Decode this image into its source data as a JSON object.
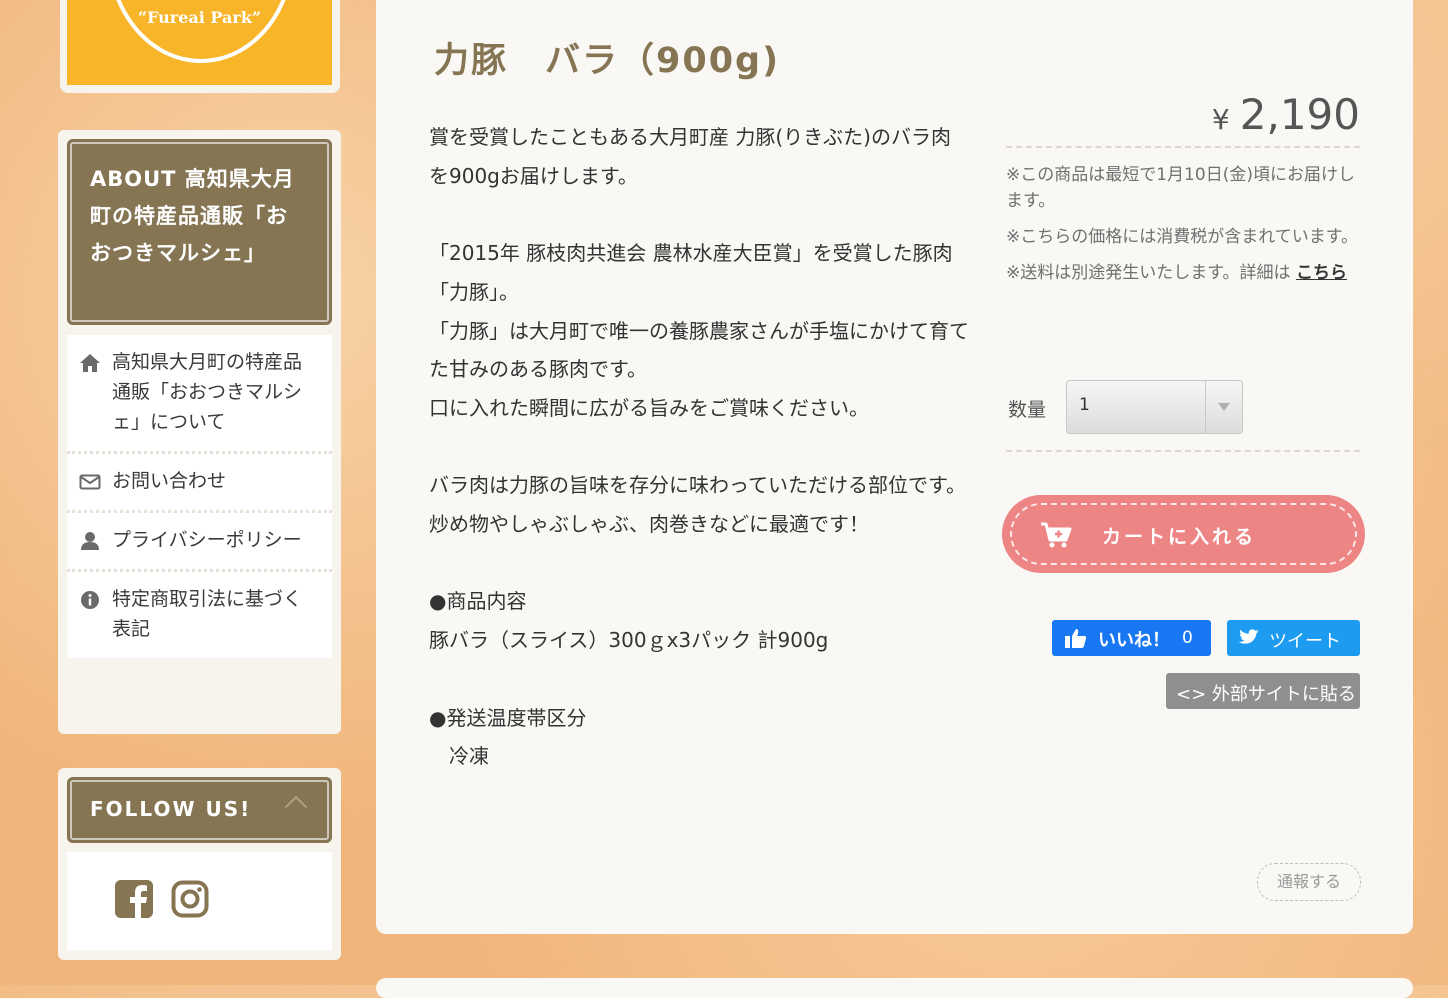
{
  "logo": {
    "text": "“Fureai Park”"
  },
  "about": {
    "title": "ABOUT 高知県大月町の特産品通販「おおつきマルシェ」",
    "items": [
      {
        "label": "高知県大月町の特産品通販「おおつきマルシェ」について",
        "icon": "home-icon"
      },
      {
        "label": "お問い合わせ",
        "icon": "envelope-icon"
      },
      {
        "label": "プライバシーポリシー",
        "icon": "user-icon"
      },
      {
        "label": "特定商取引法に基づく表記",
        "icon": "info-circle-icon"
      }
    ]
  },
  "follow": {
    "title": "FOLLOW US!",
    "icons": [
      "facebook-icon",
      "instagram-icon"
    ]
  },
  "product": {
    "title": "力豚　バラ（900g)",
    "description": [
      "賞を受賞したこともある大月町産 力豚(りきぶた)のバラ肉を900gお届けします。",
      "",
      "「2015年 豚枝肉共進会 農林水産大臣賞」を受賞した豚肉「力豚」。",
      "「力豚」は大月町で唯一の養豚農家さんが手塩にかけて育てた甘みのある豚肉です。",
      "口に入れた瞬間に広がる旨みをご賞味ください。",
      "",
      "バラ肉は力豚の旨味を存分に味わっていただける部位です。炒め物やしゃぶしゃぶ、肉巻きなどに最適です！",
      "",
      "●商品内容",
      "豚バラ（スライス）300ｇx3パック 計900g",
      "",
      "●発送温度帯区分",
      "　冷凍"
    ],
    "price_symbol": "¥",
    "price": "2,190",
    "note_shipping_date": "※この商品は最短で1月10日(金)頃にお届けします。",
    "note_tax": "※こちらの価格には消費税が含まれています。",
    "note_postage": "※送料は別途発生いたします。詳細は",
    "note_link": "こちら",
    "quantity_label": "数量",
    "quantity_value": "1",
    "cart_label": "カートに入れる"
  },
  "social": {
    "like_label": "いいね！",
    "like_count": "0",
    "tweet_label": "ツイート",
    "embed_label": "<> 外部サイトに貼る",
    "report_label": "通報する"
  },
  "colors": {
    "accent_brown": "#857553",
    "cart_pink": "#ee8585",
    "logo_yellow": "#f9b52a",
    "facebook_blue": "#1877f2",
    "twitter_blue": "#1d9bf0"
  }
}
